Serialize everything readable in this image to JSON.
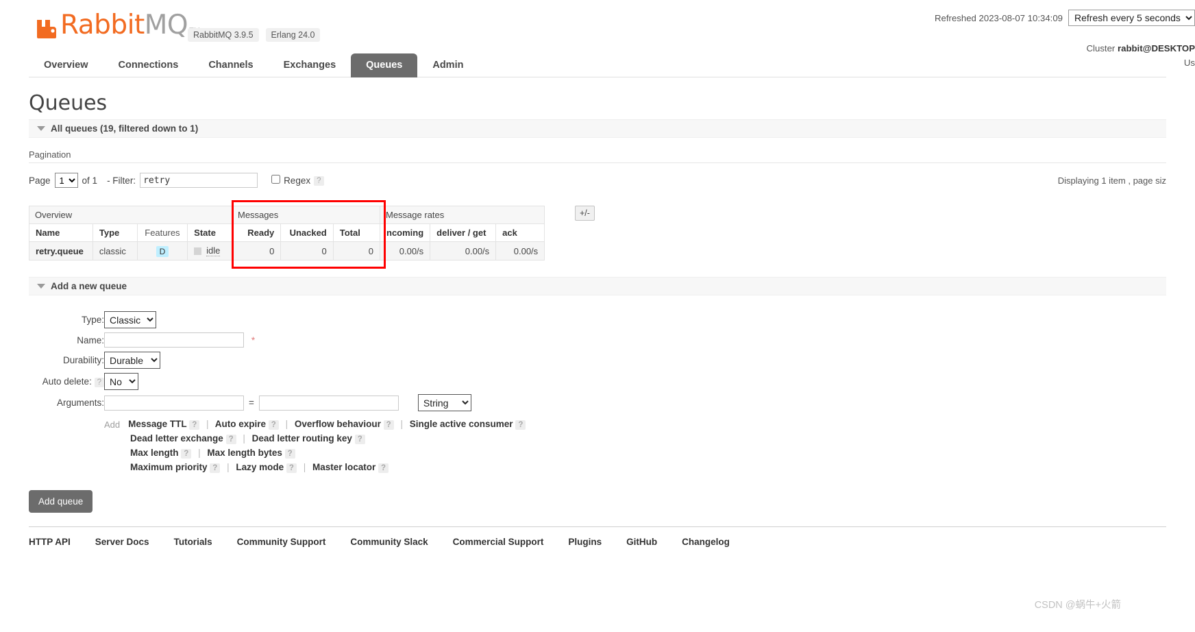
{
  "header": {
    "logo_rabbit": "Rabbit",
    "logo_mq": "MQ",
    "logo_tm": "TM",
    "version_badges": [
      "RabbitMQ 3.9.5",
      "Erlang 24.0"
    ],
    "refreshed_text": "Refreshed 2023-08-07 10:34:09",
    "refresh_select": "Refresh every 5 seconds",
    "cluster_label": "Cluster",
    "cluster_name": "rabbit@DESKTOP",
    "user_label": "Us"
  },
  "nav": {
    "items": [
      {
        "label": "Overview",
        "active": false
      },
      {
        "label": "Connections",
        "active": false
      },
      {
        "label": "Channels",
        "active": false
      },
      {
        "label": "Exchanges",
        "active": false
      },
      {
        "label": "Queues",
        "active": true
      },
      {
        "label": "Admin",
        "active": false
      }
    ]
  },
  "page": {
    "title": "Queues",
    "all_queues_header": "All queues (19, filtered down to 1)",
    "pagination_label": "Pagination"
  },
  "filter": {
    "page_label": "Page",
    "page_value": "1",
    "of_label": "of 1",
    "dash_filter_label": "- Filter:",
    "filter_value": "retry",
    "regex_label": "Regex",
    "help": "?",
    "displaying": "Displaying 1 item , page siz"
  },
  "table": {
    "groups": [
      {
        "label": "Overview",
        "span": 4
      },
      {
        "label": "Messages",
        "span": 3
      },
      {
        "label": "Message rates",
        "span": 3
      }
    ],
    "plusminus": "+/-",
    "columns": [
      {
        "label": "Name",
        "align": "left",
        "bold": true
      },
      {
        "label": "Type",
        "align": "left",
        "bold": true
      },
      {
        "label": "Features",
        "align": "center",
        "bold": false
      },
      {
        "label": "State",
        "align": "left",
        "bold": true
      },
      {
        "label": "Ready",
        "align": "right",
        "bold": true
      },
      {
        "label": "Unacked",
        "align": "right",
        "bold": true
      },
      {
        "label": "Total",
        "align": "left",
        "bold": true
      },
      {
        "label": "ncoming",
        "align": "left",
        "bold": true
      },
      {
        "label": "deliver / get",
        "align": "left",
        "bold": true
      },
      {
        "label": "ack",
        "align": "left",
        "bold": true
      }
    ],
    "rows": [
      {
        "name": "retry.queue",
        "type": "classic",
        "features": "D",
        "state": "idle",
        "ready": "0",
        "unacked": "0",
        "total": "0",
        "incoming": "0.00/s",
        "deliver_get": "0.00/s",
        "ack": "0.00/s"
      }
    ]
  },
  "add_queue": {
    "section_title": "Add a new queue",
    "type_label": "Type:",
    "type_value": "Classic",
    "name_label": "Name:",
    "name_value": "",
    "durability_label": "Durability:",
    "durability_value": "Durable",
    "autodelete_label": "Auto delete:",
    "autodelete_value": "No",
    "arguments_label": "Arguments:",
    "arg_key": "",
    "arg_value": "",
    "arg_type": "String",
    "equals": "=",
    "add_link": "Add",
    "help": "?",
    "preset_rows": [
      [
        "Message TTL",
        "Auto expire",
        "Overflow behaviour",
        "Single active consumer"
      ],
      [
        "Dead letter exchange",
        "Dead letter routing key"
      ],
      [
        "Max length",
        "Max length bytes"
      ],
      [
        "Maximum priority",
        "Lazy mode",
        "Master locator"
      ]
    ],
    "submit_label": "Add queue"
  },
  "footer": {
    "links": [
      "HTTP API",
      "Server Docs",
      "Tutorials",
      "Community Support",
      "Community Slack",
      "Commercial Support",
      "Plugins",
      "GitHub",
      "Changelog"
    ]
  },
  "watermark": "CSDN @蜗牛+火箭",
  "colors": {
    "brand_orange": "#f26b21",
    "active_tab": "#6c6c6c",
    "highlight_red": "#ff0000",
    "feature_badge": "#bfefff"
  }
}
